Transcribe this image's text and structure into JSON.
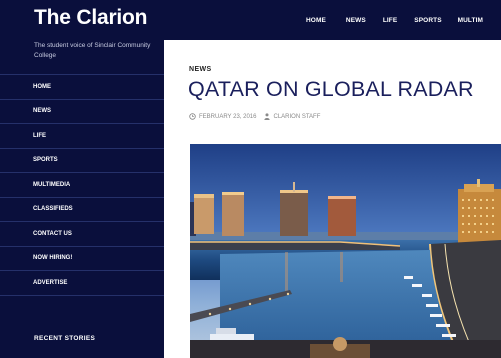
{
  "header": {
    "site_title": "The Clarion",
    "nav": [
      "HOME",
      "NEWS",
      "LIFE",
      "SPORTS",
      "MULTIM"
    ]
  },
  "sidebar": {
    "tagline": "The student voice of Sinclair Community College",
    "items": [
      {
        "label": "HOME"
      },
      {
        "label": "NEWS"
      },
      {
        "label": "LIFE"
      },
      {
        "label": "SPORTS"
      },
      {
        "label": "MULTIMEDIA"
      },
      {
        "label": "CLASSIFIEDS"
      },
      {
        "label": "CONTACT US"
      },
      {
        "label": "NOW HIRING!"
      },
      {
        "label": "ADVERTISE"
      }
    ],
    "recent_stories": "RECENT STORIES"
  },
  "article": {
    "category": "NEWS",
    "title": "QATAR ON GLOBAL RADAR",
    "date": "FEBRUARY 23, 2016",
    "author": "CLARION STAFF",
    "date_icon": "clock-icon",
    "author_icon": "person-icon"
  },
  "colors": {
    "navy": "#0a0f3c",
    "headline": "#1a1f5c",
    "meta": "#8a8a8a"
  }
}
